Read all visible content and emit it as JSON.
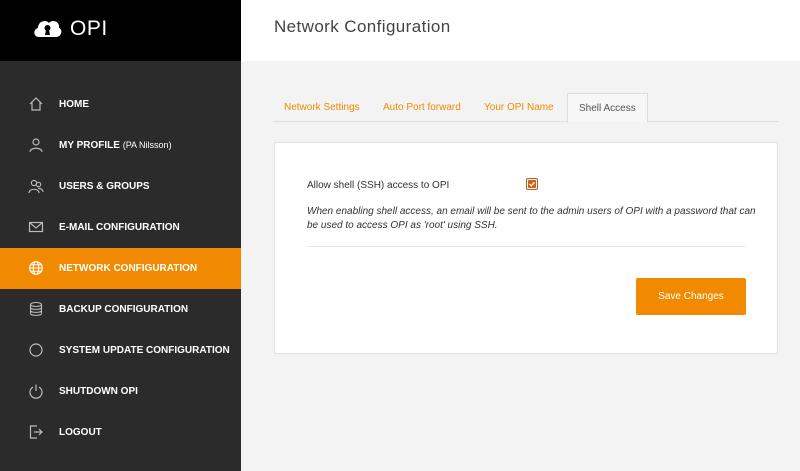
{
  "brand": {
    "name": "OPI",
    "logo_icon": "keyhole-cloud-icon"
  },
  "header": {
    "title": "Network Configuration"
  },
  "sidebar": {
    "active_color": "#f18a00",
    "items": [
      {
        "label": "HOME",
        "icon": "home-icon"
      },
      {
        "label": "MY PROFILE",
        "sub": "(PA Nilsson)",
        "icon": "user-icon"
      },
      {
        "label": "USERS & GROUPS",
        "icon": "users-icon"
      },
      {
        "label": "E-MAIL CONFIGURATION",
        "icon": "mail-icon"
      },
      {
        "label": "NETWORK CONFIGURATION",
        "icon": "globe-icon",
        "active": true
      },
      {
        "label": "BACKUP CONFIGURATION",
        "icon": "database-icon"
      },
      {
        "label": "SYSTEM UPDATE CONFIGURATION",
        "icon": "circle-icon"
      },
      {
        "label": "SHUTDOWN OPI",
        "icon": "power-icon"
      },
      {
        "label": "LOGOUT",
        "icon": "logout-icon"
      }
    ]
  },
  "tabs": [
    {
      "label": "Network Settings"
    },
    {
      "label": "Auto Port forward"
    },
    {
      "label": "Your OPI Name"
    },
    {
      "label": "Shell Access",
      "active": true
    }
  ],
  "shell_access": {
    "field_label": "Allow shell (SSH) access to OPI",
    "checked": true,
    "help_text": "When enabling shell access, an email will be sent to the admin users of OPI with a password that can be used to access OPI as 'root' using SSH.",
    "save_label": "Save Changes"
  }
}
